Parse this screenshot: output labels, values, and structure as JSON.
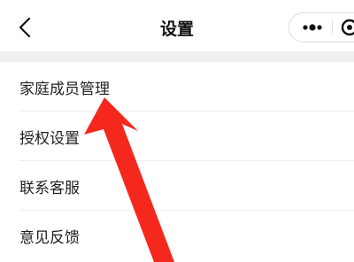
{
  "nav": {
    "title": "设置",
    "back_icon": "chevron-left-icon",
    "more_icon": "more-dots-icon",
    "close_icon": "target-close-icon"
  },
  "menu": {
    "items": [
      {
        "label": "家庭成员管理"
      },
      {
        "label": "授权设置"
      },
      {
        "label": "联系客服"
      },
      {
        "label": "意见反馈"
      }
    ]
  },
  "annotation": {
    "icon": "red-arrow",
    "color": "#f5281e"
  }
}
